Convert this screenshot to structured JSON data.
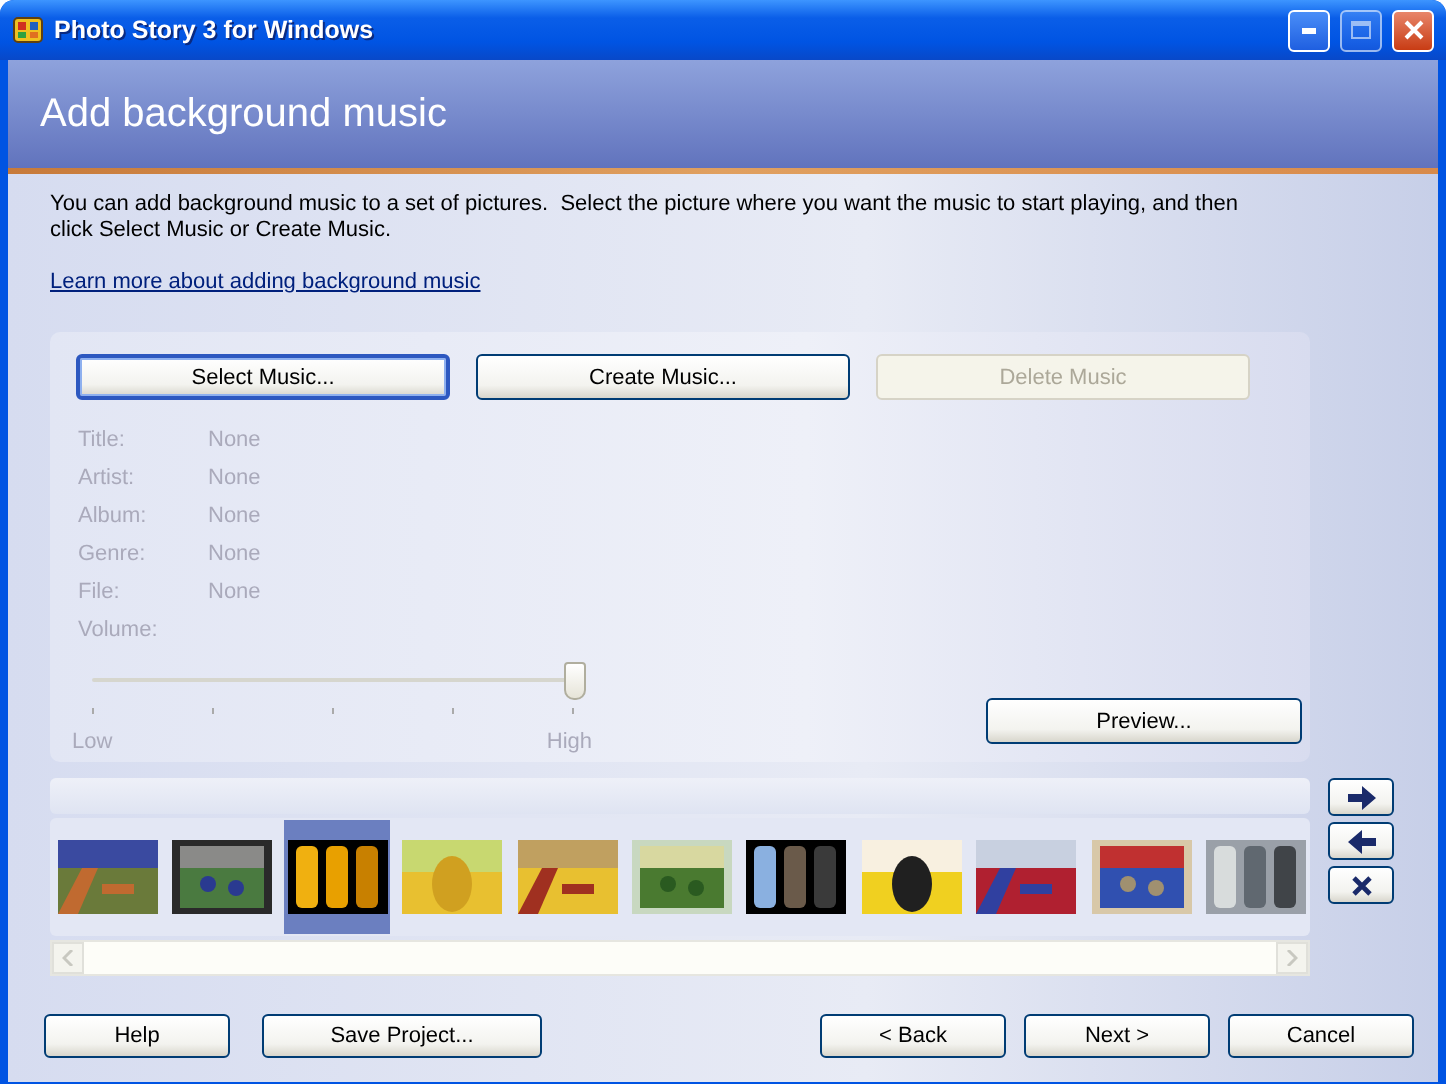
{
  "window": {
    "title": "Photo Story 3 for Windows"
  },
  "header": {
    "title": "Add background music"
  },
  "intro": "You can add background music to a set of pictures.  Select the picture where you want the music to start playing, and then click Select Music or Create Music.",
  "help_link": "Learn more about adding background music",
  "music_buttons": [
    {
      "label": "Select Music...",
      "disabled": false,
      "default": true
    },
    {
      "label": "Create Music...",
      "disabled": false,
      "default": false
    },
    {
      "label": "Delete Music",
      "disabled": true,
      "default": false
    }
  ],
  "details": {
    "disabled": true,
    "fields": [
      {
        "label": "Title:",
        "value": "None"
      },
      {
        "label": "Artist:",
        "value": "None"
      },
      {
        "label": "Album:",
        "value": "None"
      },
      {
        "label": "Genre:",
        "value": "None"
      },
      {
        "label": "File:",
        "value": "None"
      }
    ]
  },
  "volume": {
    "label": "Volume:",
    "level": 1,
    "min_label": "Low",
    "max_label": "High",
    "disabled": true
  },
  "preview_button": "Preview...",
  "filmstrip": {
    "items": [
      {
        "kind": "picture",
        "selected": false
      },
      {
        "kind": "picture",
        "selected": false
      },
      {
        "kind": "picture",
        "selected": true
      },
      {
        "kind": "picture",
        "selected": false
      },
      {
        "kind": "picture",
        "selected": false
      },
      {
        "kind": "picture",
        "selected": false
      },
      {
        "kind": "picture",
        "selected": false
      },
      {
        "kind": "picture",
        "selected": false
      },
      {
        "kind": "picture",
        "selected": false
      },
      {
        "kind": "picture",
        "selected": false
      },
      {
        "kind": "picture",
        "selected": false
      }
    ]
  },
  "footer_buttons": [
    "Help",
    "Save Project...",
    "< Back",
    "Next >",
    "Cancel"
  ]
}
